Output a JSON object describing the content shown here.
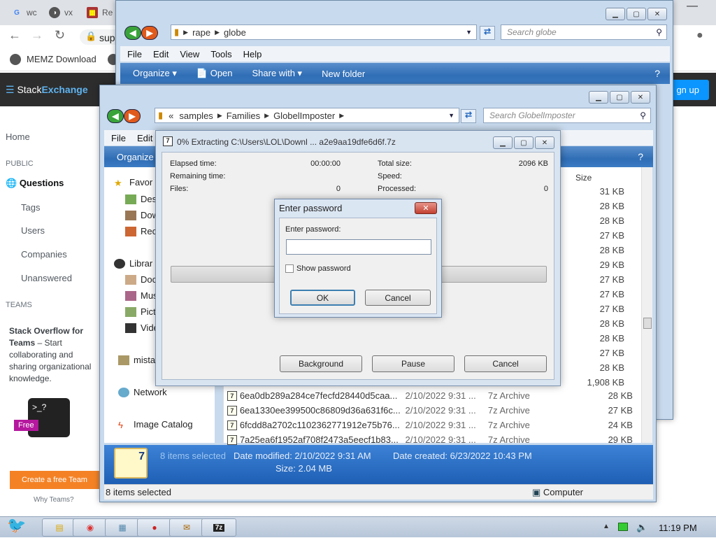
{
  "chrome": {
    "tabs": [
      {
        "icon": "G",
        "label": "wc"
      },
      {
        "icon": "◑",
        "label": "vx"
      },
      {
        "icon": "▦",
        "label": "Re"
      }
    ],
    "address_partial": "sup",
    "bookmark": "MEMZ Download"
  },
  "stackexchange": {
    "logo_a": "Stack",
    "logo_b": "Exchange",
    "signup": "gn up",
    "home": "Home",
    "public": "PUBLIC",
    "questions": "Questions",
    "tags": "Tags",
    "users": "Users",
    "companies": "Companies",
    "unanswered": "Unanswered",
    "teams_cap": "TEAMS",
    "teams_title": "Stack Overflow for Teams",
    "teams_body": " – Start collaborating and sharing organizational knowledge.",
    "free": "Free",
    "cta": "Create a free Team",
    "why": "Why Teams?"
  },
  "explorer_back": {
    "path": [
      "rape",
      "globe"
    ],
    "search_placeholder": "Search globe",
    "menu": [
      "File",
      "Edit",
      "View",
      "Tools",
      "Help"
    ],
    "commands": [
      "Organize",
      "Open",
      "Share with",
      "New folder"
    ]
  },
  "explorer_front": {
    "path": [
      "«",
      "samples",
      "Families",
      "GlobelImposter"
    ],
    "search_placeholder": "Search GlobelImposter",
    "menu": [
      "File",
      "Edit"
    ],
    "organize": "Organize",
    "size_header": "Size",
    "nav": {
      "favorites": "Favor",
      "desktop": "Des",
      "downloads": "Dow",
      "recent": "Rec",
      "libraries": "Librar",
      "documents": "Doc",
      "music": "Mus",
      "pictures": "Pictu",
      "videos": "Vide",
      "homegroup": "mistal",
      "network": "Network",
      "image_catalog": "Image Catalog"
    },
    "sizes": [
      "31 KB",
      "28 KB",
      "28 KB",
      "27 KB",
      "28 KB",
      "29 KB",
      "27 KB",
      "27 KB",
      "27 KB",
      "28 KB",
      "28 KB",
      "27 KB",
      "28 KB",
      "1,908 KB"
    ],
    "files": [
      {
        "name": "6ea0db289a284ce7fecfd28440d5caa...",
        "date": "2/10/2022 9:31 ...",
        "type": "7z Archive",
        "size": "28 KB"
      },
      {
        "name": "6ea1330ee399500c86809d36a631f6c...",
        "date": "2/10/2022 9:31 ...",
        "type": "7z Archive",
        "size": "27 KB"
      },
      {
        "name": "6fcdd8a2702c1102362771912e75b76...",
        "date": "2/10/2022 9:31 ...",
        "type": "7z Archive",
        "size": "24 KB"
      },
      {
        "name": "7a25ea6f1952af708f2473a5eecf1b83...",
        "date": "2/10/2022 9:31 ...",
        "type": "7z Archive",
        "size": "29 KB"
      }
    ],
    "details": {
      "selected": "8 items selected",
      "modified": "Date modified: 2/10/2022 9:31 AM",
      "created": "Date created: 6/23/2022 10:43 PM",
      "size": "Size: 2.04 MB"
    },
    "status": "8 items selected",
    "computer": "Computer"
  },
  "zip": {
    "title": "0% Extracting C:\\Users\\LOL\\Downl ... a2e9aa19dfe6d6f.7z",
    "elapsed_label": "Elapsed time:",
    "elapsed": "00:00:00",
    "remaining_label": "Remaining time:",
    "files_label": "Files:",
    "files": "0",
    "total_label": "Total size:",
    "total": "2096 KB",
    "speed_label": "Speed:",
    "processed_label": "Processed:",
    "processed": "0",
    "progress": 0,
    "background": "Background",
    "pause": "Pause",
    "cancel": "Cancel"
  },
  "password": {
    "title": "Enter password",
    "label": "Enter password:",
    "value": "",
    "show": "Show password",
    "show_checked": false,
    "ok": "OK",
    "cancel": "Cancel"
  },
  "taskbar": {
    "clock": "11:19 PM"
  }
}
